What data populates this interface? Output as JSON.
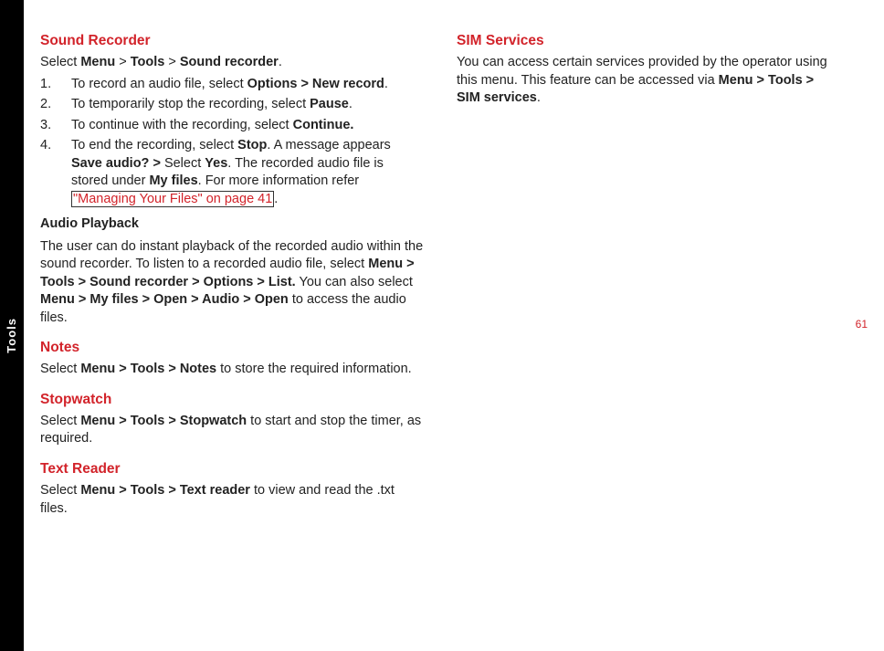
{
  "side_tab": "Tools",
  "page_number": "61",
  "left_column": {
    "sound_recorder": {
      "title": "Sound Recorder",
      "intro_prefix": "Select ",
      "intro_b1": "Menu",
      "intro_gt1": " > ",
      "intro_b2": "Tools",
      "intro_gt2": " > ",
      "intro_b3": "Sound recorder",
      "intro_suffix": ".",
      "items": [
        {
          "t1": "To record an audio file, select ",
          "b1": "Options > New record",
          "t2": "."
        },
        {
          "t1": "To temporarily stop the recording, select ",
          "b1": "Pause",
          "t2": "."
        },
        {
          "t1": "To continue with the recording, select ",
          "b1": "Continue.",
          "t2": ""
        },
        {
          "t1": "To end the recording, select ",
          "b1": "Stop",
          "t2": ". A message appears ",
          "b2": "Save audio? >",
          "t3": " Select ",
          "b3": "Yes",
          "t4": ". The recorded audio file is stored under ",
          "b4": "My files",
          "t5": ". For more information refer ",
          "link": "\"Managing Your Files\" on page 41",
          "t6": "."
        }
      ],
      "sub_heading": "Audio Playback",
      "playback_t1": "The user can do instant playback of the recorded audio within the sound recorder. To listen to a recorded audio file, select ",
      "playback_b1": "Menu > Tools > Sound recorder > Options > List.",
      "playback_t2": " You can also select ",
      "playback_b2": "Menu > My files > Open > Audio > Open",
      "playback_t3": " to access the audio files."
    },
    "notes": {
      "title": "Notes",
      "t1": "Select ",
      "b1": "Menu > Tools > Notes",
      "t2": " to store the required information."
    },
    "stopwatch": {
      "title": "Stopwatch",
      "t1": "Select ",
      "b1": "Menu > Tools > Stopwatch",
      "t2": " to start and stop the timer, as required."
    },
    "text_reader": {
      "title": "Text Reader",
      "t1": "Select ",
      "b1": "Menu > Tools > Text reader",
      "t2": " to view and read the .txt files."
    }
  },
  "right_column": {
    "sim_services": {
      "title": "SIM Services",
      "t1": "You can access certain services provided by the operator using this menu. This feature can be accessed via ",
      "b1": "Menu > Tools > SIM services",
      "t2": "."
    }
  }
}
